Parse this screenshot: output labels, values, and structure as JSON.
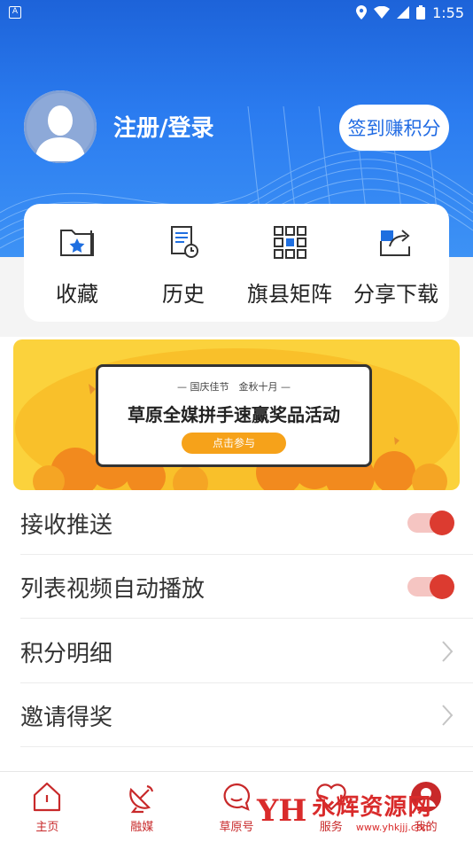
{
  "status_bar": {
    "time": "1:55",
    "notification_icon": "A"
  },
  "profile": {
    "login_label": "注册/登录",
    "signin_button": "签到赚积分"
  },
  "quick_actions": [
    {
      "label": "收藏",
      "icon": "favorite-folder-icon"
    },
    {
      "label": "历史",
      "icon": "history-doc-icon"
    },
    {
      "label": "旗县矩阵",
      "icon": "grid-matrix-icon"
    },
    {
      "label": "分享下载",
      "icon": "share-icon"
    }
  ],
  "banner": {
    "subtitle": "— 国庆佳节　金秋十月 —",
    "title": "草原全媒拼手速赢奖品活动",
    "button": "点击参与"
  },
  "settings": [
    {
      "label": "接收推送",
      "type": "toggle",
      "on": true
    },
    {
      "label": "列表视频自动播放",
      "type": "toggle",
      "on": true
    },
    {
      "label": "积分明细",
      "type": "link"
    },
    {
      "label": "邀请得奖",
      "type": "link"
    }
  ],
  "bottom_nav": [
    {
      "label": "主页",
      "icon": "home-icon"
    },
    {
      "label": "融媒",
      "icon": "satellite-icon"
    },
    {
      "label": "草原号",
      "icon": "chat-icon"
    },
    {
      "label": "服务",
      "icon": "heart-icon"
    },
    {
      "label": "我的",
      "icon": "profile-icon"
    }
  ],
  "watermark": {
    "mark": "YH",
    "name": "永辉资源网",
    "url": "www.yhkjjj.com"
  },
  "colors": {
    "header_blue": "#2b7cf0",
    "accent_red": "#dc3b30",
    "banner_yellow": "#fbd23c"
  }
}
